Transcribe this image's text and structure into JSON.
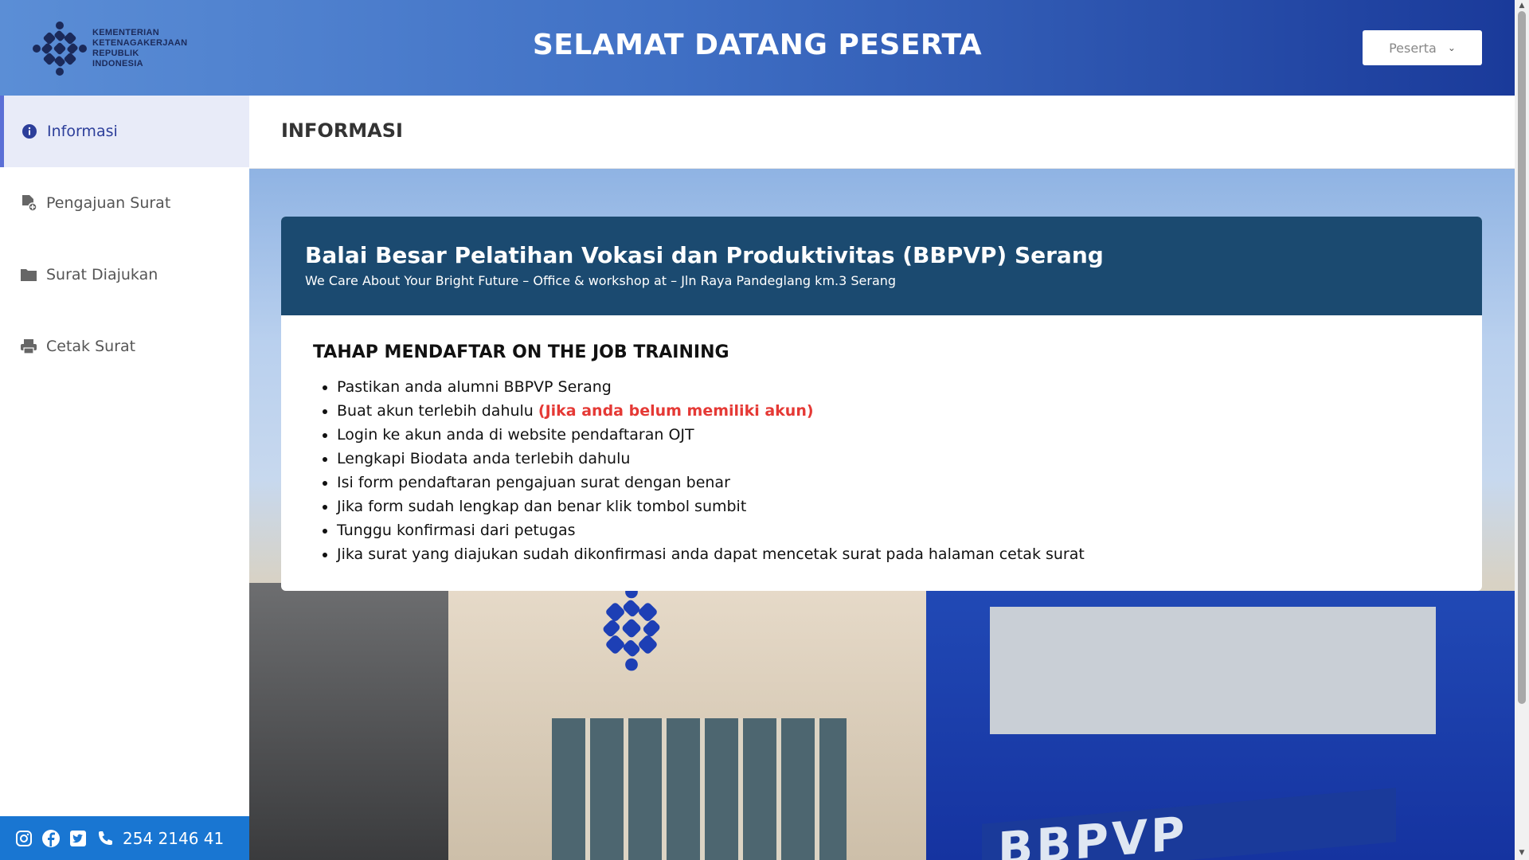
{
  "header": {
    "logo_lines": [
      "KEMENTERIAN",
      "KETENAGAKERJAAN",
      "REPUBLIK",
      "INDONESIA"
    ],
    "title": "SELAMAT DATANG PESERTA",
    "user_menu_label": "Peserta"
  },
  "sidebar": {
    "items": [
      {
        "label": "Informasi",
        "icon": "info-circle-icon",
        "active": true
      },
      {
        "label": "Pengajuan Surat",
        "icon": "file-plus-icon",
        "active": false
      },
      {
        "label": "Surat Diajukan",
        "icon": "folder-icon",
        "active": false
      },
      {
        "label": "Cetak Surat",
        "icon": "printer-icon",
        "active": false
      }
    ],
    "footer": {
      "icons": [
        "instagram-icon",
        "facebook-icon",
        "twitter-icon",
        "phone-icon"
      ],
      "phone": "254 2146 41"
    }
  },
  "page": {
    "title": "INFORMASI"
  },
  "card": {
    "title": "Balai Besar Pelatihan Vokasi dan Produktivitas (BBPVP) Serang",
    "subtitle": "We Care About Your Bright Future – Office & workshop at – Jln Raya Pandeglang km.3 Serang",
    "section_title": "TAHAP MENDAFTAR ON THE JOB TRAINING",
    "steps": [
      "Pastikan anda alumni BBPVP Serang",
      "Buat akun terlebih dahulu ",
      "Login ke akun anda di website pendaftaran OJT",
      "Lengkapi Biodata anda terlebih dahulu",
      "Isi form pendaftaran pengajuan surat dengan benar",
      "Jika form sudah lengkap dan benar klik tombol sumbit",
      "Tunggu konfirmasi dari petugas",
      "Jika surat yang diajukan sudah dikonfirmasi anda dapat mencetak surat pada halaman cetak surat"
    ],
    "step2_link": "(Jika anda belum memiliki akun)"
  },
  "background": {
    "sign_text": "BBPVP SERANG"
  },
  "colors": {
    "header_gradient_start": "#5b8ed6",
    "header_gradient_end": "#1a3a9a",
    "card_header": "#1b4a70",
    "footer_bar": "#1976d2",
    "link_red": "#e53935",
    "active_item_bg": "#e8ebf8"
  }
}
